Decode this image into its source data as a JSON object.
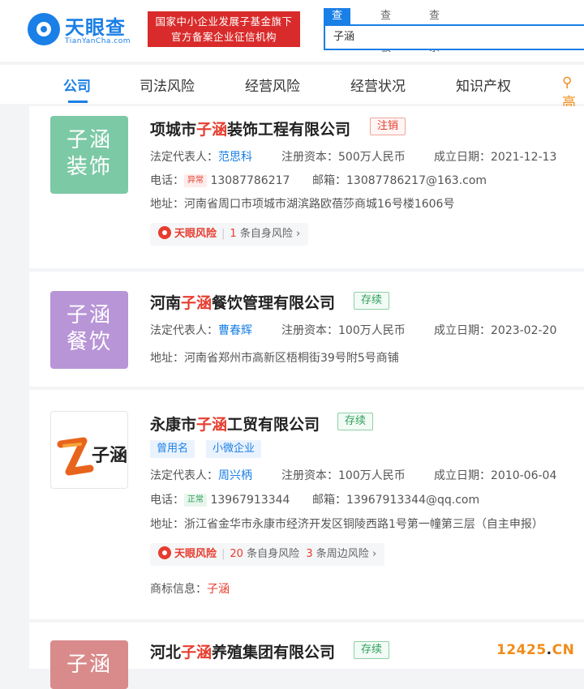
{
  "header": {
    "logo_text": "天眼查",
    "logo_sub": "TianYanCha.com",
    "banner_line1": "国家中小企业发展子基金旗下",
    "banner_line2": "官方备案企业征信机构",
    "search_tabs": [
      "查公司",
      "查老板",
      "查关系"
    ],
    "search_value": "子涵"
  },
  "nav": {
    "items": [
      "公司",
      "司法风险",
      "经营风险",
      "经营状况",
      "知识产权"
    ],
    "more": "高"
  },
  "labels": {
    "legal_rep": "法定代表人：",
    "capital": "注册资本：",
    "founded": "成立日期：",
    "phone": "电话：",
    "email": "邮箱：",
    "address": "地址：",
    "trademark": "商标信息：",
    "risk_label": "天眼风险",
    "self_risk": "条自身风险",
    "nearby_risk": "条周边风险"
  },
  "results": [
    {
      "logo_line1": "子涵",
      "logo_line2": "装饰",
      "logo_color": "#7cc9a5",
      "name_pre": "项城市",
      "name_hl": "子涵",
      "name_post": "装饰工程有限公司",
      "status": "注销",
      "legal_rep": "范思科",
      "capital": "500万人民币",
      "founded": "2021-12-13",
      "phone_badge": "异常",
      "phone": "13087786217",
      "email": "13087786217@163.com",
      "address": "河南省周口市项城市湖滨路欧蓓莎商城16号楼1606号",
      "self_risk_count": "1"
    },
    {
      "logo_line1": "子涵",
      "logo_line2": "餐饮",
      "logo_color": "#b895d6",
      "name_pre": "河南",
      "name_hl": "子涵",
      "name_post": "餐饮管理有限公司",
      "status": "存续",
      "legal_rep": "曹春辉",
      "capital": "100万人民币",
      "founded": "2023-02-20",
      "address": "河南省郑州市高新区梧桐街39号附5号商铺"
    },
    {
      "logo_text": "子涵",
      "name_pre": "永康市",
      "name_hl": "子涵",
      "name_post": "工贸有限公司",
      "status": "存续",
      "tags": [
        "曾用名",
        "小微企业"
      ],
      "legal_rep": "周兴柄",
      "capital": "100万人民币",
      "founded": "2010-06-04",
      "phone_badge": "正常",
      "phone": "13967913344",
      "email": "13967913344@qq.com",
      "address": "浙江省金华市永康市经济开发区铜陵西路1号第一幢第三层（自主申报）",
      "self_risk_count": "20",
      "nearby_risk_count": "3",
      "trademark": "子涵"
    },
    {
      "logo_line1": "子涵",
      "logo_color": "#d98b8b",
      "name_pre": "河北",
      "name_hl": "子涵",
      "name_post": "养殖集团有限公司",
      "status": "存续"
    }
  ],
  "watermark": {
    "num": "12425",
    "dot": ".",
    "tld": "CN"
  },
  "colors": {
    "brand": "#1a7fe6",
    "highlight": "#e63d2e",
    "banner": "#d92b2b",
    "status_green": "#2fa05a"
  }
}
